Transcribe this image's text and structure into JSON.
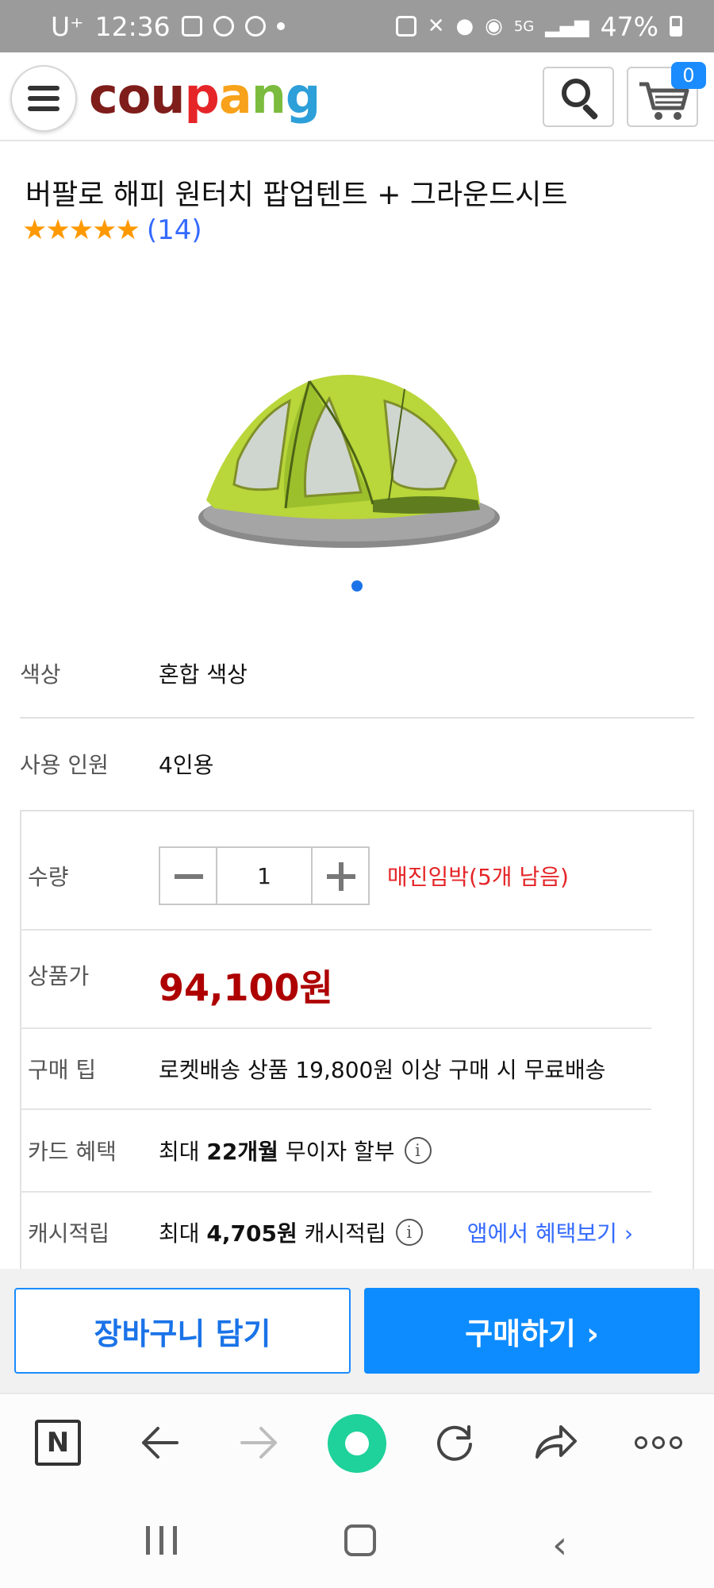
{
  "status_bar": {
    "carrier": "U⁺",
    "time": "12:36",
    "battery": "47%",
    "network": "5G"
  },
  "header": {
    "logo": {
      "c": "c",
      "o": "o",
      "u": "u",
      "p": "p",
      "a": "a",
      "n": "n",
      "g": "g"
    },
    "cart_count": "0"
  },
  "product": {
    "title": "버팔로 해피 원터치 팝업텐트 + 그라운드시트",
    "stars": "★★★★★",
    "review_count": "(14)"
  },
  "options": [
    {
      "label": "색상",
      "value": "혼합 색상"
    },
    {
      "label": "사용 인원",
      "value": "4인용"
    }
  ],
  "purchase": {
    "quantity_label": "수량",
    "quantity_value": "1",
    "stock_notice": "매진임박(5개 남음)",
    "price_label": "상품가",
    "price": "94,100원",
    "tip_label": "구매 팁",
    "tip_text": "로켓배송 상품 19,800원 이상 구매 시 무료배송",
    "card_label": "카드 혜택",
    "card_prefix": "최대 ",
    "card_bold": "22개월",
    "card_suffix": " 무이자 할부",
    "cash_label": "캐시적립",
    "cash_prefix": "최대 ",
    "cash_bold": "4,705원",
    "cash_suffix": " 캐시적립",
    "app_link": "앱에서 혜택보기 ›"
  },
  "buttons": {
    "add_to_cart": "장바구니 담기",
    "buy": "구매하기 ›"
  },
  "browser": {
    "n_label": "N"
  },
  "colors": {
    "coupang_c": "#7e1d1a",
    "coupang_o": "#7e1d1a",
    "coupang_u": "#7e1d1a",
    "coupang_p": "#e52528",
    "coupang_a": "#f7a21a",
    "coupang_n": "#7bbc3e",
    "coupang_g": "#2d9fd9",
    "price": "#ae0000",
    "stock": "#e52528",
    "accent_blue": "#0d8cff",
    "star": "#ff9900"
  }
}
